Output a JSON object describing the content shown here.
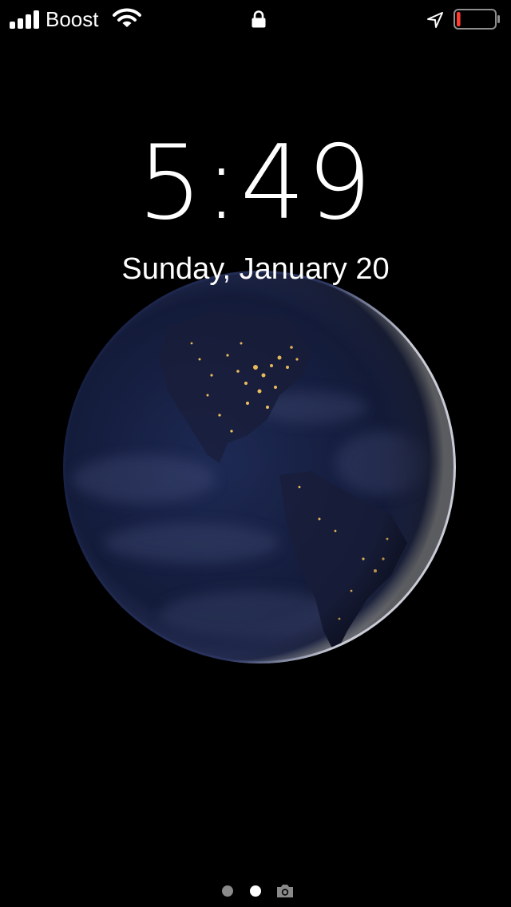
{
  "status_bar": {
    "carrier": "Boost",
    "signal_bars": 4,
    "battery_level_percent": 10,
    "battery_color": "#ff3b30",
    "icons": [
      "signal-icon",
      "wifi-icon",
      "lock-icon",
      "location-icon",
      "battery-icon"
    ]
  },
  "lock_screen": {
    "time": "5:49",
    "date": "Sunday, January 20"
  },
  "wallpaper": {
    "subject": "earth-at-night-icon",
    "ocean_color": "#1a2348",
    "city_lights_color": "#ffcc66"
  },
  "pager": {
    "pages": 2,
    "current_page": 2,
    "trailing_icon": "camera-icon"
  }
}
